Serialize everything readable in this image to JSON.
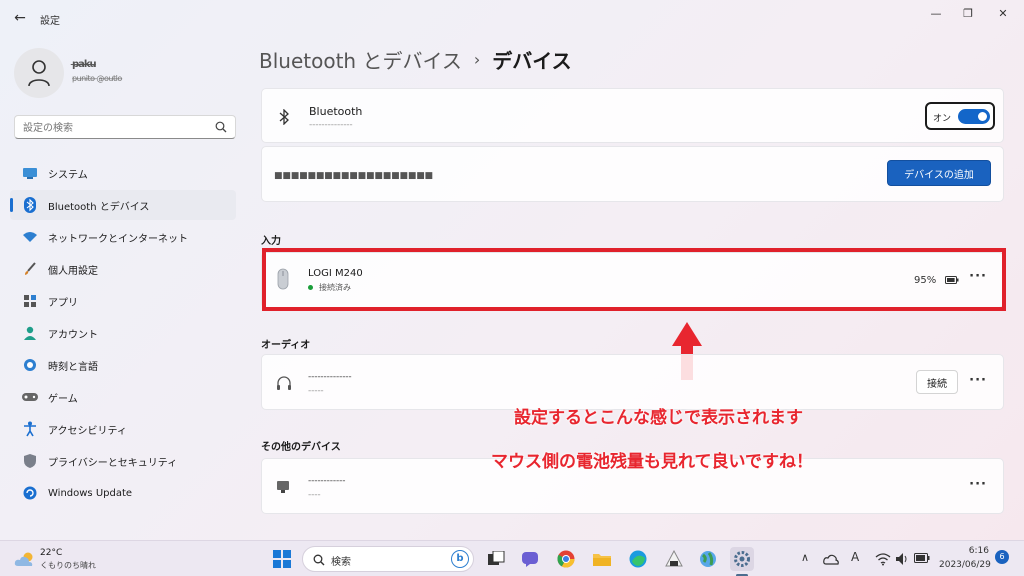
{
  "window": {
    "app_title": "設定",
    "back_glyph": "←",
    "min_glyph": "—",
    "max_glyph": "❐",
    "close_glyph": "✕"
  },
  "user": {
    "name": "p̶a̶k̶u̶",
    "email": "p̶u̶n̶i̶t̶o̶ ̶@̶o̶u̶t̶l̶o̶"
  },
  "search": {
    "placeholder": "設定の検索"
  },
  "sidebar": {
    "items": [
      {
        "label": "システム",
        "icon": "monitor-icon",
        "active": false
      },
      {
        "label": "Bluetooth とデバイス",
        "icon": "bluetooth-icon",
        "active": true
      },
      {
        "label": "ネットワークとインターネット",
        "icon": "wifi-icon",
        "active": false
      },
      {
        "label": "個人用設定",
        "icon": "brush-icon",
        "active": false
      },
      {
        "label": "アプリ",
        "icon": "apps-icon",
        "active": false
      },
      {
        "label": "アカウント",
        "icon": "person-icon",
        "active": false
      },
      {
        "label": "時刻と言語",
        "icon": "globe-clock-icon",
        "active": false
      },
      {
        "label": "ゲーム",
        "icon": "gamepad-icon",
        "active": false
      },
      {
        "label": "アクセシビリティ",
        "icon": "accessibility-icon",
        "active": false
      },
      {
        "label": "プライバシーとセキュリティ",
        "icon": "shield-icon",
        "active": false
      },
      {
        "label": "Windows Update",
        "icon": "update-icon",
        "active": false
      }
    ]
  },
  "breadcrumb": {
    "parent": "Bluetooth とデバイス",
    "separator": "›",
    "current": "デバイス"
  },
  "bluetooth_card": {
    "title": "Bluetooth",
    "subtitle": "- - - - - - - - - - - - - -",
    "toggle_label": "オン",
    "toggle_on": true
  },
  "add_device_card": {
    "description": "■ ■ ■ ■ ■ ■ ■ ■ ■ ■ ■ ■ ■ ■ ■ ■ ■ ■ ■",
    "button_label": "デバイスの追加"
  },
  "sections": {
    "input": "入力",
    "audio": "オーディオ",
    "other": "その他のデバイス"
  },
  "mouse_device": {
    "name": "LOGI M240",
    "status": "接続済み",
    "battery": "95%",
    "battery_level": 0.95
  },
  "audio_device": {
    "name": "- - - - - - - - - - - - - -",
    "subtitle": "- - - - -",
    "connect_label": "接続"
  },
  "other_device": {
    "name": "- - - - - - - - - - - -",
    "subtitle": "- - - -"
  },
  "more_glyph": "···",
  "annotations": {
    "line1": "設定するとこんな感じで表示されます",
    "line2": "マウス側の電池残量も見れて良いですね！",
    "color": "#e8262f"
  },
  "taskbar": {
    "weather_temp": "22°C",
    "weather_desc": "くもりのち晴れ",
    "search_placeholder": "検索",
    "time": "6:16",
    "date": "2023/06/29",
    "notification_count": "6",
    "ime_glyph": "A"
  },
  "colors": {
    "accent": "#1a62bf",
    "highlight": "#e0212b",
    "connected": "#1a9e3a"
  }
}
